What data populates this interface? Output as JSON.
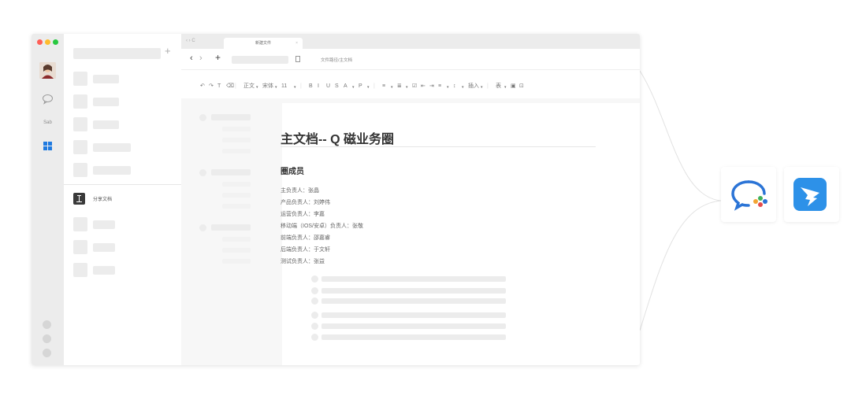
{
  "window": {
    "traffic_colors": [
      "#ff5f57",
      "#febc2e",
      "#28c840"
    ],
    "list_add_label": "+"
  },
  "rail": {
    "avatar_icon": "user-avatar",
    "chat_icon": "chat-bubble-icon",
    "abc_label": "Sab",
    "apps_icon": "grid-apps-icon",
    "accent": "#1f7ae0"
  },
  "list": {
    "file_label": "分享文档"
  },
  "tabbar": {
    "tab_label": "新建文件",
    "nav_glyphs": "‹ › C",
    "tab_close": "×"
  },
  "addrbar": {
    "back": "‹",
    "forward": "›",
    "new": "+",
    "path_text": "文件路径/主文档"
  },
  "toolbar": {
    "items": [
      "↶",
      "↷",
      "T",
      "⌫",
      "|",
      "正文",
      "▾",
      "宋体",
      "▾",
      "11",
      "▾",
      "|",
      "B",
      "I",
      "U",
      "S",
      "A",
      "▾",
      "P",
      "▾",
      "|",
      "≡",
      "▾",
      "≣",
      "▾",
      "☑",
      "⇤",
      "⇥",
      "≡",
      "▾",
      "↕",
      "▾",
      "插入",
      "▾",
      "|",
      "表",
      "▾",
      "▣",
      "⊡"
    ]
  },
  "document": {
    "title": "主文档-- Q 磁业务圈",
    "section_heading": "圈成员",
    "members": [
      "主负责人：张晶",
      "产品负责人：刘婷伟",
      "运营负责人：李嘉",
      "移动端（IOS/安卓）负责人：张敬",
      "前端负责人：邵嘉睿",
      "后端负责人：于文轩",
      "测试负责人：张益"
    ]
  },
  "integrations": {
    "logos": [
      {
        "name": "wecom-logo-icon",
        "color": "#2b74d6"
      },
      {
        "name": "dingtalk-logo-icon",
        "color": "#2d91e8"
      }
    ]
  }
}
